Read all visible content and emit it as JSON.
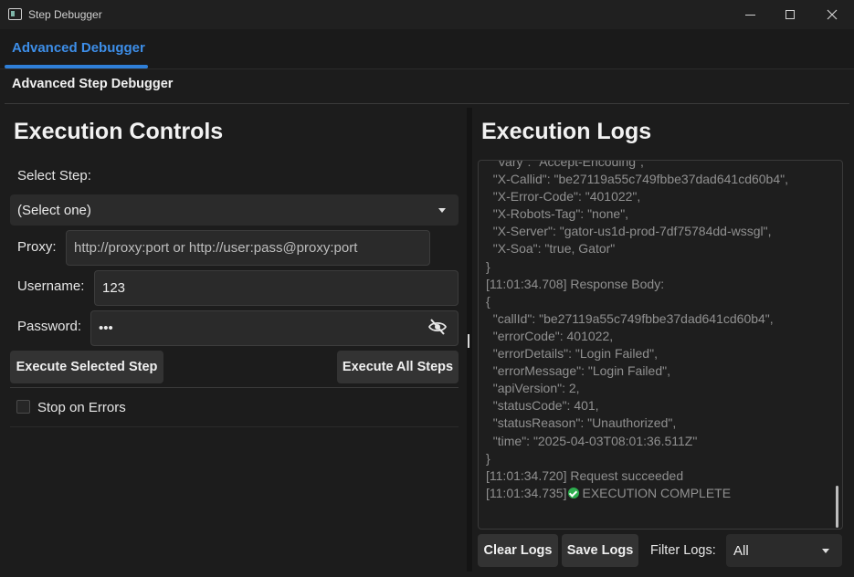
{
  "window": {
    "title": "Step Debugger",
    "icon": "app-window-icon",
    "controls": [
      "minimize-icon",
      "maximize-icon",
      "close-icon"
    ]
  },
  "tabs": [
    {
      "label": "Advanced Debugger",
      "active": true
    }
  ],
  "header": {
    "title": "Advanced Step Debugger"
  },
  "controls": {
    "title": "Execution Controls",
    "select_step_label": "Select Step:",
    "select_step_value": "(Select one)",
    "proxy_label": "Proxy:",
    "proxy_placeholder": "http://proxy:port or http://user:pass@proxy:port",
    "username_label": "Username:",
    "username_value": "123",
    "password_label": "Password:",
    "password_value": "•••",
    "password_toggle_icon": "eye-slash-icon",
    "execute_selected_label": "Execute Selected Step",
    "execute_all_label": "Execute All Steps",
    "stop_on_errors_label": "Stop on Errors",
    "stop_on_errors_checked": false
  },
  "logs": {
    "title": "Execution Logs",
    "lines": [
      "  \"Vary\": \"Accept-Encoding\",",
      "  \"X-Callid\": \"be27119a55c749fbbe37dad641cd60b4\",",
      "  \"X-Error-Code\": \"401022\",",
      "  \"X-Robots-Tag\": \"none\",",
      "  \"X-Server\": \"gator-us1d-prod-7df75784dd-wssgl\",",
      "  \"X-Soa\": \"true, Gator\"",
      "}",
      "[11:01:34.708] Response Body:",
      "{",
      "  \"callId\": \"be27119a55c749fbbe37dad641cd60b4\",",
      "  \"errorCode\": 401022,",
      "  \"errorDetails\": \"Login Failed\",",
      "  \"errorMessage\": \"Login Failed\",",
      "  \"apiVersion\": 2,",
      "  \"statusCode\": 401,",
      "  \"statusReason\": \"Unauthorized\",",
      "  \"time\": \"2025-04-03T08:01:36.511Z\"",
      "}",
      "[11:01:34.720] Request succeeded"
    ],
    "final_timestamp": "[11:01:34.735]",
    "final_icon": "check-circle-icon",
    "final_message": "EXECUTION COMPLETE",
    "clear_label": "Clear Logs",
    "save_label": "Save Logs",
    "filter_label": "Filter Logs:",
    "filter_value": "All"
  },
  "colors": {
    "accent": "#2f7fd8",
    "background": "#1c1c1c",
    "success": "#2eae4f"
  }
}
